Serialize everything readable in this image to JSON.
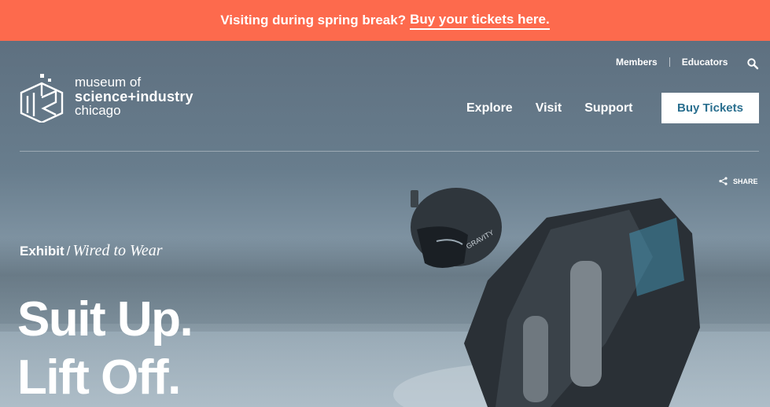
{
  "banner": {
    "text": "Visiting during spring break?",
    "link": "Buy your tickets here."
  },
  "logo": {
    "line1": "museum of",
    "line2": "science+industry",
    "line3": "chicago"
  },
  "utility_nav": {
    "members": "Members",
    "educators": "Educators"
  },
  "main_nav": {
    "explore": "Explore",
    "visit": "Visit",
    "support": "Support"
  },
  "buy_button": "Buy Tickets",
  "share_label": "SHARE",
  "hero": {
    "eyebrow_kind": "Exhibit",
    "eyebrow_sep": "/",
    "eyebrow_title": "Wired to Wear",
    "headline_line1": "Suit Up.",
    "headline_line2": "Lift Off."
  },
  "colors": {
    "banner": "#fd6a4d",
    "buy_button_text": "#2a6f8f"
  },
  "icons": {
    "search": "search-icon",
    "share": "share-icon",
    "logo": "msi-logo-icon"
  }
}
